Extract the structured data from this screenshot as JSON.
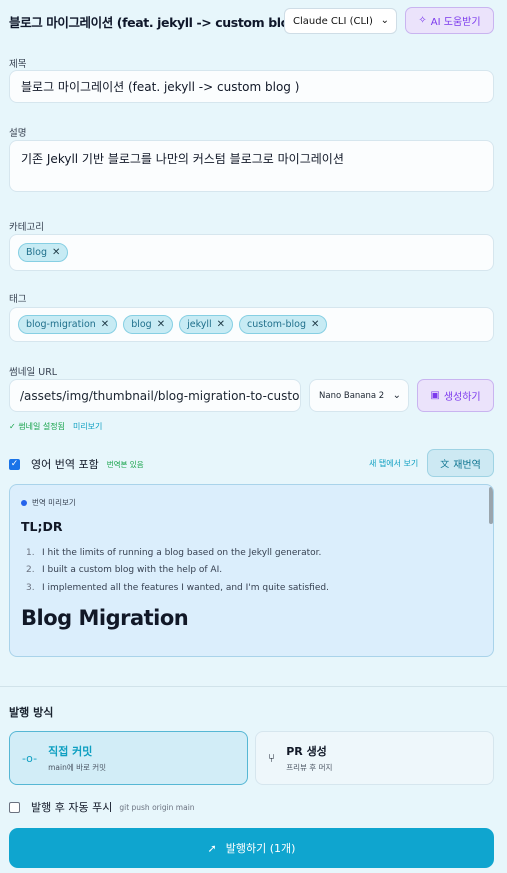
{
  "header": {
    "title": "블로그 마이그레이션 (feat. jekyll -> custom blog )",
    "model_select": "Claude CLI (CLI)",
    "ai_help_label": "AI 도움받기"
  },
  "form": {
    "title_label": "제목",
    "title_value": "블로그 마이그레이션 (feat. jekyll -> custom blog )",
    "description_label": "설명",
    "description_value": "기존 Jekyll 기반 블로그를 나만의 커스텀 블로그로 마이그레이션",
    "category_label": "카테고리",
    "categories": [
      "Blog"
    ],
    "tags_label": "태그",
    "tags": [
      "blog-migration",
      "blog",
      "jekyll",
      "custom-blog"
    ],
    "thumbnail_label": "썸네일 URL",
    "thumbnail_value": "/assets/img/thumbnail/blog-migration-to-custom",
    "image_model": "Nano Banana 2",
    "generate_label": "생성하기",
    "thumbnail_status": "썸네일 설정됨",
    "thumbnail_preview_link": "미리보기"
  },
  "translation": {
    "include_label": "영어 번역 포함",
    "include_checked": true,
    "badge": "번역본 있음",
    "open_new_tab": "새 탭에서 보기",
    "retranslate_label": "재번역",
    "preview_header": "번역 미리보기",
    "tldr_heading": "TL;DR",
    "list": [
      "I hit the limits of running a blog based on the Jekyll generator.",
      "I built a custom blog with the help of AI.",
      "I implemented all the features I wanted, and I'm quite satisfied."
    ],
    "heading": "Blog Migration"
  },
  "publish": {
    "section_title": "발행 방식",
    "modes": [
      {
        "name": "직접 커밋",
        "desc": "main에 바로 커밋",
        "active": true
      },
      {
        "name": "PR 생성",
        "desc": "프리뷰 후 머지",
        "active": false
      }
    ],
    "auto_push_label": "발행 후 자동 푸시",
    "auto_push_hint": "git push origin main",
    "auto_push_checked": false,
    "publish_button": "발행하기 (1개)"
  },
  "colors": {
    "background": "#e7f6fb",
    "accent": "#0fa5cf",
    "ai_purple": "#7c3aed",
    "success": "#16a34a"
  }
}
